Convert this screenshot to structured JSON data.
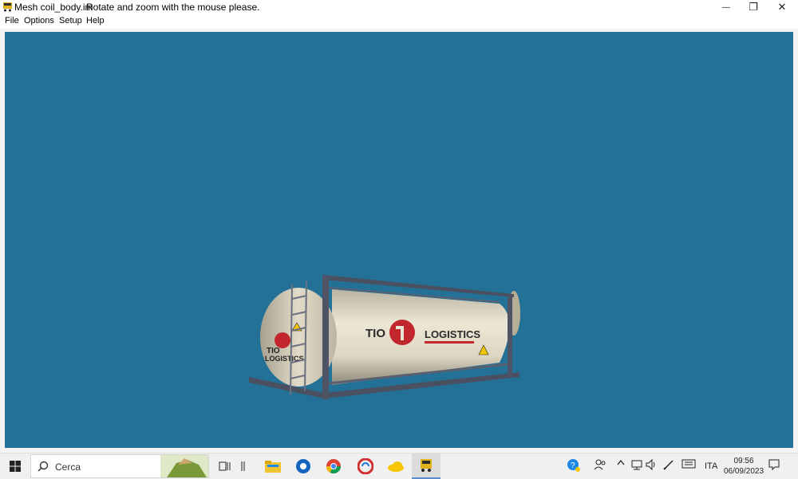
{
  "window": {
    "title": "Mesh coil_body.im",
    "hint": "Rotate and zoom with the mouse please.",
    "controls": {
      "minimize": "—",
      "restore": "❐",
      "close": "✕"
    }
  },
  "menu": {
    "items": [
      "File",
      "Options",
      "Setup",
      "Help"
    ]
  },
  "viewport": {
    "background": "#247198",
    "model": {
      "brand_left": "TIO",
      "brand_right": "LOGISTICS",
      "end_brand_top": "TIO",
      "end_brand_bottom": "LOGISTICS"
    }
  },
  "taskbar": {
    "search_placeholder": "Cerca",
    "language": "ITA",
    "time": "09:56",
    "date": "06/09/2023"
  }
}
